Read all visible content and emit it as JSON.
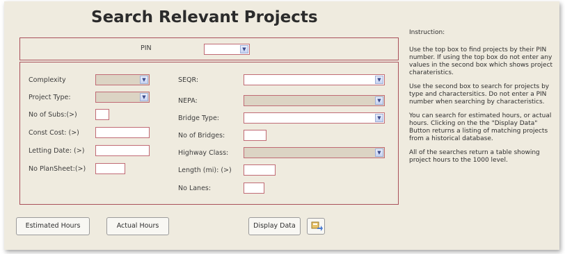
{
  "title": "Search Relevant Projects",
  "pin_box": {
    "label": "PIN",
    "value": ""
  },
  "search_box": {
    "left": {
      "complexity_label": "Complexity",
      "project_type_label": "Project Type:",
      "no_of_subs_label": "No of Subs:(>)",
      "const_cost_label": "Const Cost: (>)",
      "letting_date_label": "Letting Date: (>)",
      "no_plansheet_label": "No PlanSheet:(>)"
    },
    "right": {
      "seqr_label": "SEQR:",
      "nepa_label": "NEPA:",
      "bridge_type_label": "Bridge Type:",
      "no_of_bridges_label": "No of Bridges:",
      "highway_class_label": "Highway Class:",
      "length_label": "Length (mi): (>)",
      "no_lanes_label": "No Lanes:"
    }
  },
  "buttons": {
    "estimated_hours": "Estimated Hours",
    "actual_hours": "Actual Hours",
    "display_data": "Display Data"
  },
  "instructions": {
    "heading": "Instruction:",
    "p1": "Use the top box to find projects by their PIN number. If using the top box do not enter any values in the second box which shows project charateristics.",
    "p2": "Use the second box to search for projects by type and charactersitics. Do not enter a PIN number when searching by characteristics.",
    "p3": "You can search for estimated hours, or actual hours. Clicking on the the \"Display Data\" Button returns a listing of matching projects from a historical database.",
    "p4": "All of the searches return a table showing project hours to the 1000 level."
  },
  "colors": {
    "background": "#efebdf",
    "border_accent": "#a94f5a"
  },
  "icons": {
    "dropdown_arrow": "chevron-down-icon",
    "export_icon": "export-icon"
  }
}
